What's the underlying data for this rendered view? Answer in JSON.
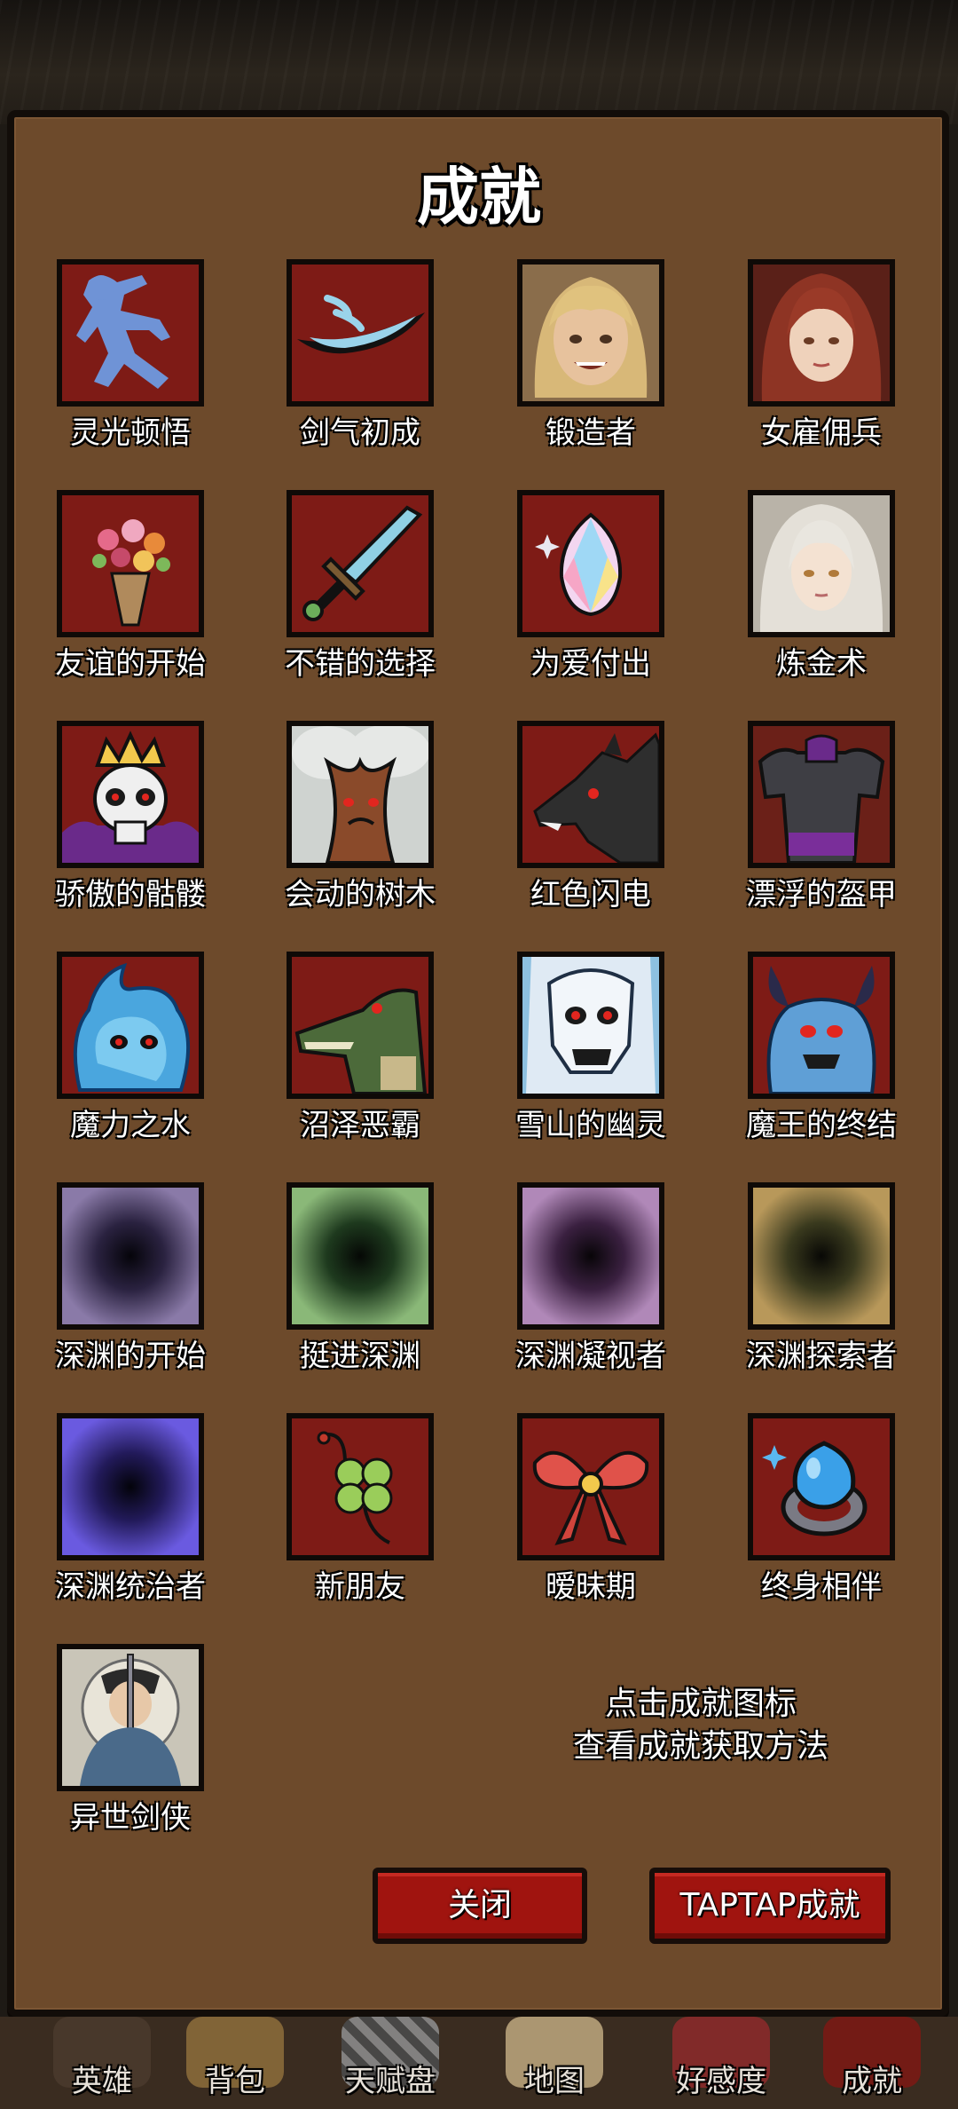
{
  "screen": {
    "title": "成就",
    "hint_line1": "点击成就图标",
    "hint_line2": "查看成就获取方法"
  },
  "achievements": [
    {
      "label": "灵光顿悟",
      "icon": "fighter-silhouette-icon"
    },
    {
      "label": "剑气初成",
      "icon": "sword-wave-icon"
    },
    {
      "label": "锻造者",
      "icon": "blonde-hero-portrait"
    },
    {
      "label": "女雇佣兵",
      "icon": "red-haired-woman-portrait"
    },
    {
      "label": "友谊的开始",
      "icon": "flower-bouquet-icon"
    },
    {
      "label": "不错的选择",
      "icon": "steel-sword-icon"
    },
    {
      "label": "为爱付出",
      "icon": "rainbow-crystal-icon"
    },
    {
      "label": "炼金术",
      "icon": "silver-haired-woman-portrait"
    },
    {
      "label": "骄傲的骷髅",
      "icon": "crowned-skull-icon"
    },
    {
      "label": "会动的树木",
      "icon": "living-tree-icon"
    },
    {
      "label": "红色闪电",
      "icon": "black-wolf-icon"
    },
    {
      "label": "漂浮的盔甲",
      "icon": "floating-armor-icon"
    },
    {
      "label": "魔力之水",
      "icon": "water-spirit-icon"
    },
    {
      "label": "沼泽恶霸",
      "icon": "crocodile-icon"
    },
    {
      "label": "雪山的幽灵",
      "icon": "snow-ghost-icon"
    },
    {
      "label": "魔王的终结",
      "icon": "demon-king-icon"
    },
    {
      "label": "深渊的开始",
      "icon": "abyss-portal-purple-icon"
    },
    {
      "label": "挺进深渊",
      "icon": "abyss-portal-green-icon"
    },
    {
      "label": "深渊凝视者",
      "icon": "abyss-portal-violet-icon"
    },
    {
      "label": "深渊探索者",
      "icon": "abyss-portal-olive-icon"
    },
    {
      "label": "深渊统治者",
      "icon": "abyss-portal-blue-icon"
    },
    {
      "label": "新朋友",
      "icon": "four-leaf-clover-icon"
    },
    {
      "label": "暧昧期",
      "icon": "red-bow-icon"
    },
    {
      "label": "终身相伴",
      "icon": "blue-gem-ring-icon"
    },
    {
      "label": "异世剑侠",
      "icon": "swordsman-portrait"
    }
  ],
  "buttons": {
    "close": "关闭",
    "taptap": "TAPTAP成就"
  },
  "nav": [
    {
      "label": "英雄",
      "icon": "hero-tab-icon"
    },
    {
      "label": "背包",
      "icon": "bag-tab-icon"
    },
    {
      "label": "天赋盘",
      "icon": "talent-board-tab-icon"
    },
    {
      "label": "地图",
      "icon": "map-tab-icon"
    },
    {
      "label": "好感度",
      "icon": "affection-tab-icon"
    },
    {
      "label": "成就",
      "icon": "achievement-tab-icon"
    }
  ],
  "colors": {
    "panel": "#6d4a2b",
    "tile": "#7e1b16",
    "button": "#a0140f"
  }
}
